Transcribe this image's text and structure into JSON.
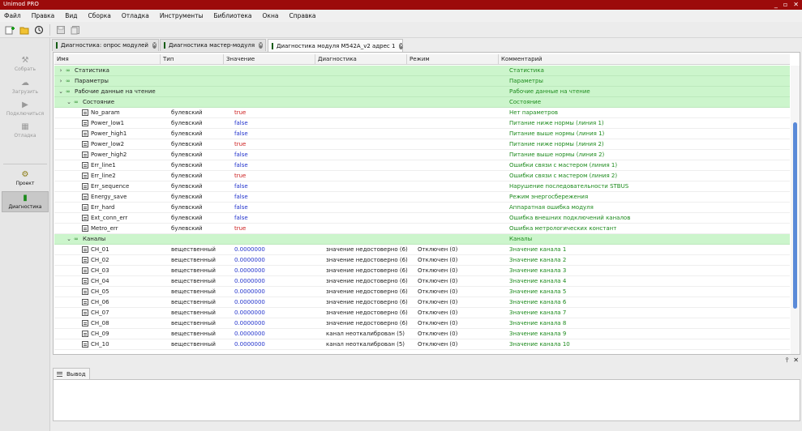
{
  "window": {
    "title": "Unimod PRO",
    "btn_min": "_",
    "btn_max": "▫",
    "btn_close": "✕"
  },
  "menu": [
    "Файл",
    "Правка",
    "Вид",
    "Сборка",
    "Отладка",
    "Инструменты",
    "Библиотека",
    "Окна",
    "Справка"
  ],
  "toolbar_icons": [
    "add-icon",
    "folder-icon",
    "history-icon",
    "save-icon",
    "save-all-icon"
  ],
  "sidebar": {
    "tools": [
      {
        "id": "build",
        "label": "Собрать",
        "icon": "⚒"
      },
      {
        "id": "upload",
        "label": "Загрузить",
        "icon": "☁"
      },
      {
        "id": "connect",
        "label": "Подключиться",
        "icon": "▶"
      },
      {
        "id": "debug",
        "label": "Отладка",
        "icon": "▦"
      }
    ],
    "views": [
      {
        "id": "project",
        "label": "Проект",
        "icon": "⚙"
      },
      {
        "id": "diagnostics",
        "label": "Диагностика",
        "icon": "▮"
      }
    ]
  },
  "tabs": [
    {
      "label": "Диагностика: опрос модулей",
      "active": false
    },
    {
      "label": "Диагностика мастер-модуля",
      "active": false
    },
    {
      "label": "Диагностика модуля M542A_v2 адрес 1",
      "active": true
    }
  ],
  "columns": [
    "Имя",
    "Тип",
    "Значение",
    "Диагностика",
    "Режим",
    "Комментарий"
  ],
  "rows": [
    {
      "level": 0,
      "exp": ">",
      "kind": "group",
      "name": "Статистика",
      "type": "",
      "value": "",
      "diag": "",
      "mode": "",
      "comment": "Статистика"
    },
    {
      "level": 0,
      "exp": ">",
      "kind": "group",
      "name": "Параметры",
      "type": "",
      "value": "",
      "diag": "",
      "mode": "",
      "comment": "Параметры"
    },
    {
      "level": 0,
      "exp": "v",
      "kind": "group",
      "name": "Рабочие данные на чтение",
      "type": "",
      "value": "",
      "diag": "",
      "mode": "",
      "comment": "Рабочие данные на чтение"
    },
    {
      "level": 1,
      "exp": "v",
      "kind": "group",
      "name": "Состояние",
      "type": "",
      "value": "",
      "diag": "",
      "mode": "",
      "comment": "Состояние"
    },
    {
      "level": 2,
      "exp": "",
      "kind": "var",
      "name": "No_param",
      "type": "булевский",
      "value": "true",
      "diag": "",
      "mode": "",
      "comment": "Нет параметров"
    },
    {
      "level": 2,
      "exp": "",
      "kind": "var",
      "name": "Power_low1",
      "type": "булевский",
      "value": "false",
      "diag": "",
      "mode": "",
      "comment": "Питание ниже нормы (линия 1)"
    },
    {
      "level": 2,
      "exp": "",
      "kind": "var",
      "name": "Power_high1",
      "type": "булевский",
      "value": "false",
      "diag": "",
      "mode": "",
      "comment": "Питание выше нормы (линия 1)"
    },
    {
      "level": 2,
      "exp": "",
      "kind": "var",
      "name": "Power_low2",
      "type": "булевский",
      "value": "true",
      "diag": "",
      "mode": "",
      "comment": "Питание ниже нормы (линия 2)"
    },
    {
      "level": 2,
      "exp": "",
      "kind": "var",
      "name": "Power_high2",
      "type": "булевский",
      "value": "false",
      "diag": "",
      "mode": "",
      "comment": "Питание выше нормы (линия 2)"
    },
    {
      "level": 2,
      "exp": "",
      "kind": "var",
      "name": "Err_line1",
      "type": "булевский",
      "value": "false",
      "diag": "",
      "mode": "",
      "comment": "Ошибки связи с мастером (линия 1)"
    },
    {
      "level": 2,
      "exp": "",
      "kind": "var",
      "name": "Err_line2",
      "type": "булевский",
      "value": "true",
      "diag": "",
      "mode": "",
      "comment": "Ошибки связи с мастером (линия 2)"
    },
    {
      "level": 2,
      "exp": "",
      "kind": "var",
      "name": "Err_sequence",
      "type": "булевский",
      "value": "false",
      "diag": "",
      "mode": "",
      "comment": "Нарушение последовательности STBUS"
    },
    {
      "level": 2,
      "exp": "",
      "kind": "var",
      "name": "Energy_save",
      "type": "булевский",
      "value": "false",
      "diag": "",
      "mode": "",
      "comment": "Режим энергосбережения"
    },
    {
      "level": 2,
      "exp": "",
      "kind": "var",
      "name": "Err_hard",
      "type": "булевский",
      "value": "false",
      "diag": "",
      "mode": "",
      "comment": "Аппаратная ошибка модуля"
    },
    {
      "level": 2,
      "exp": "",
      "kind": "var",
      "name": "Ext_conn_err",
      "type": "булевский",
      "value": "false",
      "diag": "",
      "mode": "",
      "comment": "Ошибка внешних подключений каналов"
    },
    {
      "level": 2,
      "exp": "",
      "kind": "var",
      "name": "Metro_err",
      "type": "булевский",
      "value": "true",
      "diag": "",
      "mode": "",
      "comment": "Ошибка метрологических констант"
    },
    {
      "level": 1,
      "exp": "v",
      "kind": "group",
      "name": "Каналы",
      "type": "",
      "value": "",
      "diag": "",
      "mode": "",
      "comment": "Каналы"
    },
    {
      "level": 2,
      "exp": "",
      "kind": "var",
      "name": "CH_01",
      "type": "вещественный",
      "value": "0.0000000",
      "diag": "значение недостоверно (6)",
      "mode": "Отключен (0)",
      "comment": "Значение канала  1"
    },
    {
      "level": 2,
      "exp": "",
      "kind": "var",
      "name": "CH_02",
      "type": "вещественный",
      "value": "0.0000000",
      "diag": "значение недостоверно (6)",
      "mode": "Отключен (0)",
      "comment": "Значение канала  2"
    },
    {
      "level": 2,
      "exp": "",
      "kind": "var",
      "name": "CH_03",
      "type": "вещественный",
      "value": "0.0000000",
      "diag": "значение недостоверно (6)",
      "mode": "Отключен (0)",
      "comment": "Значение канала  3"
    },
    {
      "level": 2,
      "exp": "",
      "kind": "var",
      "name": "CH_04",
      "type": "вещественный",
      "value": "0.0000000",
      "diag": "значение недостоверно (6)",
      "mode": "Отключен (0)",
      "comment": "Значение канала  4"
    },
    {
      "level": 2,
      "exp": "",
      "kind": "var",
      "name": "CH_05",
      "type": "вещественный",
      "value": "0.0000000",
      "diag": "значение недостоверно (6)",
      "mode": "Отключен (0)",
      "comment": "Значение канала  5"
    },
    {
      "level": 2,
      "exp": "",
      "kind": "var",
      "name": "CH_06",
      "type": "вещественный",
      "value": "0.0000000",
      "diag": "значение недостоверно (6)",
      "mode": "Отключен (0)",
      "comment": "Значение канала  6"
    },
    {
      "level": 2,
      "exp": "",
      "kind": "var",
      "name": "CH_07",
      "type": "вещественный",
      "value": "0.0000000",
      "diag": "значение недостоверно (6)",
      "mode": "Отключен (0)",
      "comment": "Значение канала  7"
    },
    {
      "level": 2,
      "exp": "",
      "kind": "var",
      "name": "CH_08",
      "type": "вещественный",
      "value": "0.0000000",
      "diag": "значение недостоверно (6)",
      "mode": "Отключен (0)",
      "comment": "Значение канала  8"
    },
    {
      "level": 2,
      "exp": "",
      "kind": "var",
      "name": "CH_09",
      "type": "вещественный",
      "value": "0.0000000",
      "diag": "канал неоткалиброван (5)",
      "mode": "Отключен (0)",
      "comment": "Значение канала  9"
    },
    {
      "level": 2,
      "exp": "",
      "kind": "var",
      "name": "CH_10",
      "type": "вещественный",
      "value": "0.0000000",
      "diag": "канал неоткалиброван (5)",
      "mode": "Отключен (0)",
      "comment": "Значение канала  10"
    }
  ],
  "output": {
    "tab_label": "Вывод",
    "pin": "⫯",
    "close": "✕"
  },
  "colors": {
    "titlebar": "#9c0b0b",
    "group_row": "#ccf5cc",
    "comment": "#1c8a1c",
    "true": "#cc1d1d",
    "false": "#2233cc"
  }
}
